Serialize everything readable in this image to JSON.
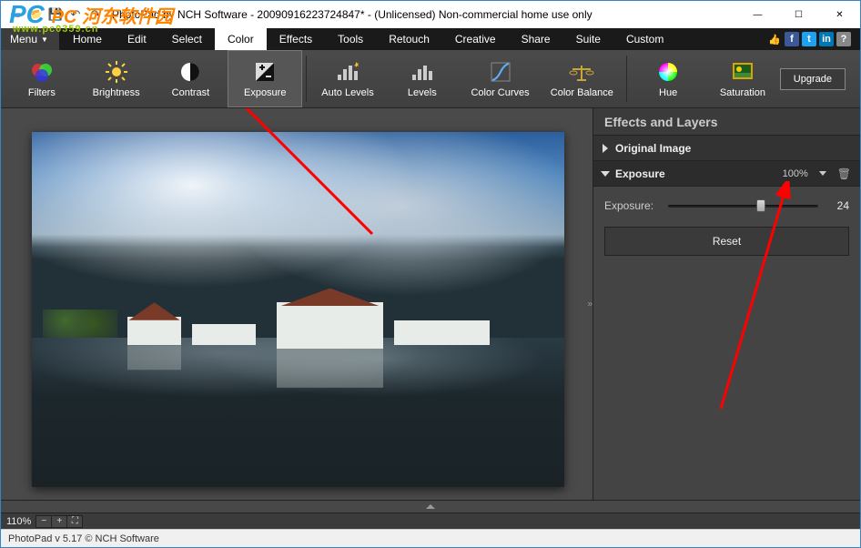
{
  "window": {
    "title": "PhotoPad by NCH Software - 20090916223724847* - (Unlicensed) Non-commercial home use only"
  },
  "menu": {
    "button": "Menu",
    "items": [
      "Home",
      "Edit",
      "Select",
      "Color",
      "Effects",
      "Tools",
      "Retouch",
      "Creative",
      "Share",
      "Suite",
      "Custom"
    ],
    "active_index": 3
  },
  "toolbar": {
    "items": [
      {
        "label": "Filters"
      },
      {
        "label": "Brightness"
      },
      {
        "label": "Contrast"
      },
      {
        "label": "Exposure"
      },
      {
        "label": "Auto Levels"
      },
      {
        "label": "Levels"
      },
      {
        "label": "Color Curves"
      },
      {
        "label": "Color Balance"
      },
      {
        "label": "Hue"
      },
      {
        "label": "Saturation"
      }
    ],
    "selected_index": 3,
    "upgrade": "Upgrade"
  },
  "panel": {
    "title": "Effects and Layers",
    "original": "Original Image",
    "exposure_label": "Exposure",
    "exposure_percent": "100%",
    "slider": {
      "label": "Exposure:",
      "value": "24",
      "pos_pct": 62
    },
    "reset": "Reset"
  },
  "zoom": {
    "level": "110%"
  },
  "status": {
    "text": "PhotoPad v 5.17  © NCH Software"
  },
  "watermark": {
    "line1": "PC 河东软件园",
    "line2": "www.pc0359.cn"
  }
}
